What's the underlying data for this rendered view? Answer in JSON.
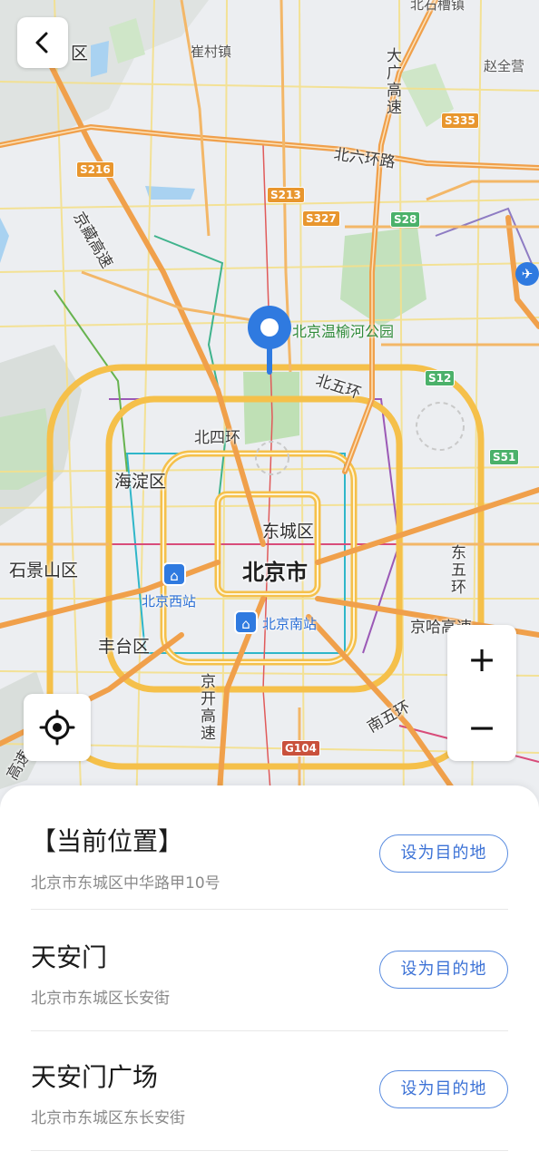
{
  "map": {
    "labels": {
      "district_top_left": "区",
      "cuicunzhen": "崔村镇",
      "beishiliang": "北石槽镇",
      "zhaoquanying": "赵全营",
      "daguang": "大广高速",
      "beiliuhuan": "北六环路",
      "jingzang": "京藏高速",
      "park": "北京温榆河公园",
      "beiwuhuan": "北五环",
      "beisihuan": "北四环",
      "haidian": "海淀区",
      "dongcheng": "东城区",
      "shijingshan": "石景山区",
      "city": "北京市",
      "dongwuhuan": "东五环",
      "beijing_west": "北京西站",
      "beijing_south": "北京南站",
      "jingha": "京哈高速",
      "fengtai": "丰台区",
      "jingkai": "京开高速",
      "nanwuhuan": "南五环",
      "bottom_left": "高速"
    },
    "badges": {
      "s335": "S335",
      "s216": "S216",
      "s213": "S213",
      "s327": "S327",
      "s28": "S28",
      "s12": "S12",
      "s51": "S51",
      "g104": "G104"
    },
    "icons": {
      "back": "chevron-left-icon",
      "locate": "crosshair-icon",
      "pin": "location-pin-icon",
      "station": "train-station-icon",
      "airport": "airplane-icon"
    },
    "colors": {
      "pin": "#2f7ae0",
      "ring_road": "#f5c04a",
      "expressway": "#f0a04b",
      "water": "#9cc9ee",
      "park": "#b7dcb0"
    }
  },
  "controls": {
    "zoom_in": "+",
    "zoom_out": "−"
  },
  "results": [
    {
      "name": "【当前位置】",
      "address": "北京市东城区中华路甲10号",
      "action": "设为目的地"
    },
    {
      "name": "天安门",
      "address": "北京市东城区长安街",
      "action": "设为目的地"
    },
    {
      "name": "天安门广场",
      "address": "北京市东城区东长安街",
      "action": "设为目的地"
    }
  ]
}
